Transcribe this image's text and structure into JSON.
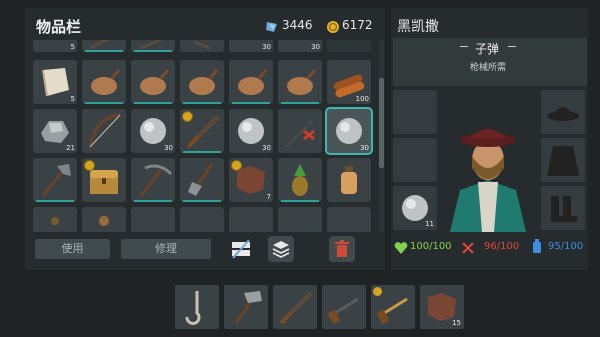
{
  "inventory": {
    "title": "物品栏",
    "currencies": [
      {
        "icon": "diamond-icon",
        "value": "3446",
        "color": "#6fa8e0"
      },
      {
        "icon": "coin-icon",
        "value": "6172",
        "color": "#e2b129"
      }
    ],
    "rows": [
      [
        {
          "icon": "stick-icon",
          "count": "5"
        },
        {
          "icon": "stick-icon",
          "count": ""
        },
        {
          "icon": "stick-icon",
          "count": ""
        },
        {
          "icon": "stick-icon",
          "count": ""
        },
        {
          "icon": "stick-icon",
          "count": "30"
        },
        {
          "icon": "stick-icon",
          "count": "30"
        }
      ],
      [
        {
          "icon": "parchment-icon",
          "count": "5"
        },
        {
          "icon": "waterskin-icon",
          "count": ""
        },
        {
          "icon": "waterskin-icon",
          "count": ""
        },
        {
          "icon": "waterskin-icon",
          "count": ""
        },
        {
          "icon": "waterskin-icon",
          "count": ""
        },
        {
          "icon": "waterskin-icon",
          "count": ""
        },
        {
          "icon": "wood-logs-icon",
          "count": "100"
        }
      ],
      [
        {
          "icon": "stone-icon",
          "count": "21"
        },
        {
          "icon": "bow-icon",
          "count": ""
        },
        {
          "icon": "cannonball-icon",
          "count": "30"
        },
        {
          "icon": "musket-icon",
          "count": ""
        },
        {
          "icon": "cannonball-icon",
          "count": "30"
        },
        {
          "icon": "broken-musket-icon",
          "count": ""
        },
        {
          "icon": "cannonball-icon",
          "count": "30"
        }
      ],
      [
        {
          "icon": "axe-icon",
          "count": ""
        },
        {
          "icon": "treasure-chest-icon",
          "count": ""
        },
        {
          "icon": "pickaxe-icon",
          "count": ""
        },
        {
          "icon": "shovel-icon",
          "count": ""
        },
        {
          "icon": "leather-hide-icon",
          "count": "7"
        },
        {
          "icon": "pineapple-icon",
          "count": ""
        },
        {
          "icon": "lantern-icon",
          "count": ""
        }
      ]
    ],
    "use_label": "使用",
    "repair_label": "修理"
  },
  "character": {
    "name": "黑凯撒",
    "selected_item": "子弹",
    "selected_desc": "枪械所需",
    "ammo_count": "11",
    "health": "100/100",
    "hunger": "96/100",
    "thirst": "95/100",
    "colors": {
      "health": "#7ed34a",
      "hunger": "#e0473a",
      "thirst": "#3d8ee0"
    }
  },
  "hotbar": [
    {
      "icon": "hook-icon",
      "count": ""
    },
    {
      "icon": "stone-hammer-icon",
      "count": ""
    },
    {
      "icon": "musket-icon",
      "count": ""
    },
    {
      "icon": "flintlock-pistol-icon",
      "count": ""
    },
    {
      "icon": "flintlock-pistol-icon",
      "count": ""
    },
    {
      "icon": "leather-hide-icon",
      "count": "15"
    }
  ]
}
